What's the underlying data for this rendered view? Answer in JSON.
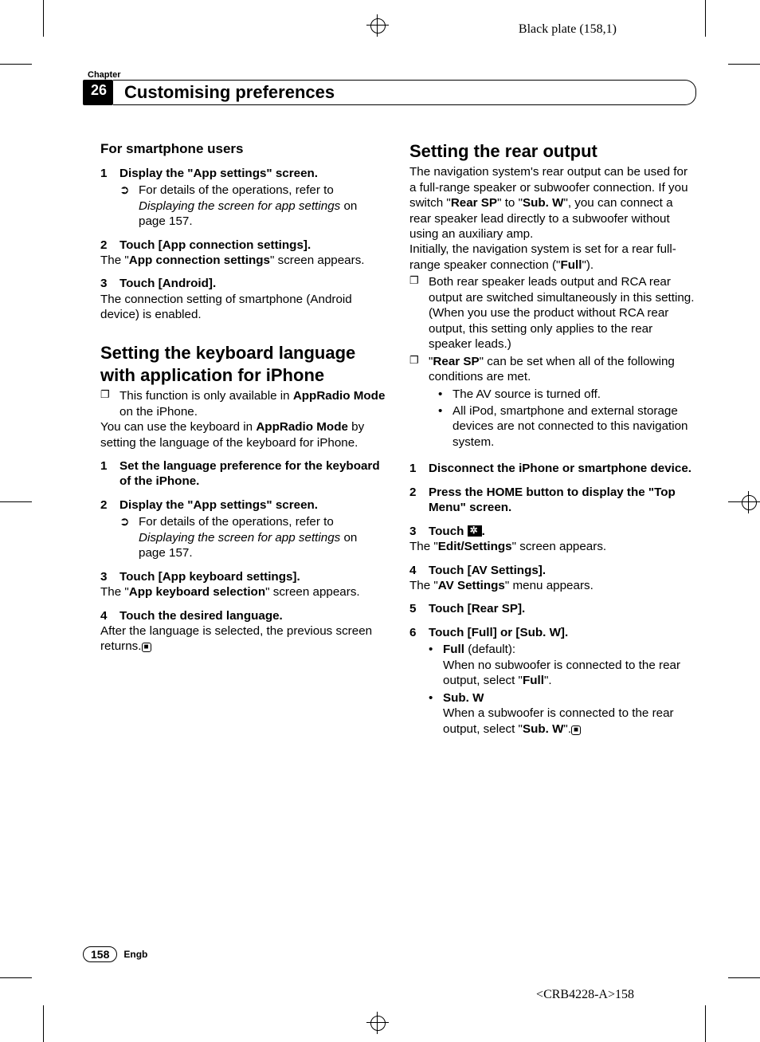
{
  "plate_label": "Black plate (158,1)",
  "chapter": {
    "label": "Chapter",
    "number": "26",
    "title": "Customising preferences"
  },
  "left": {
    "smartphone": {
      "heading": "For smartphone users",
      "s1": {
        "num": "1",
        "title": "Display the \"App settings\" screen."
      },
      "s1_ref_lead": "For details of the operations, refer to ",
      "s1_ref_ital": "Displaying the screen for app settings",
      "s1_ref_tail": " on page 157.",
      "s2": {
        "num": "2",
        "title": "Touch [App connection settings]."
      },
      "s2_body_a": "The \"",
      "s2_body_b": "App connection settings",
      "s2_body_c": "\" screen appears.",
      "s3": {
        "num": "3",
        "title": "Touch [Android]."
      },
      "s3_body": "The connection setting of smartphone (Android device) is enabled."
    },
    "keyboard": {
      "heading": "Setting the keyboard language with application for iPhone",
      "n1_a": "This function is only available in ",
      "n1_b": "AppRadio Mode",
      "n1_c": " on the iPhone.",
      "intro_a": "You can use the keyboard in ",
      "intro_b": "AppRadio Mode",
      "intro_c": " by setting the language of the keyboard for iPhone.",
      "s1": {
        "num": "1",
        "title": "Set the language preference for the keyboard of the iPhone."
      },
      "s2": {
        "num": "2",
        "title": "Display the \"App settings\" screen."
      },
      "s2_ref_lead": "For details of the operations, refer to ",
      "s2_ref_ital": "Displaying the screen for app settings",
      "s2_ref_tail": " on page 157.",
      "s3": {
        "num": "3",
        "title": "Touch [App keyboard settings]."
      },
      "s3_body_a": "The \"",
      "s3_body_b": "App keyboard selection",
      "s3_body_c": "\" screen appears.",
      "s4": {
        "num": "4",
        "title": "Touch the desired language."
      },
      "s4_body": "After the language is selected, the previous screen returns."
    }
  },
  "right": {
    "heading": "Setting the rear output",
    "p1_a": "The navigation system's rear output can be used for a full-range speaker or subwoofer connection. If you switch \"",
    "p1_b": "Rear SP",
    "p1_c": "\" to \"",
    "p1_d": "Sub. W",
    "p1_e": "\", you can connect a rear speaker lead directly to a subwoofer without using an auxiliary amp.",
    "p2_a": "Initially, the navigation system is set for a rear full-range speaker connection (\"",
    "p2_b": "Full",
    "p2_c": "\").",
    "b1": "Both rear speaker leads output and RCA rear output are switched simultaneously in this setting. (When you use the product without RCA rear output, this setting only applies to the rear speaker leads.)",
    "b2_a": "\"",
    "b2_b": "Rear SP",
    "b2_c": "\" can be set when all of the following conditions are met.",
    "b2_d1": "The AV source is turned off.",
    "b2_d2": "All iPod, smartphone and external storage devices are not connected to this navigation system.",
    "s1": {
      "num": "1",
      "title": "Disconnect the iPhone or smartphone device."
    },
    "s2": {
      "num": "2",
      "title": "Press the HOME button to display the \"Top Menu\" screen."
    },
    "s3": {
      "num": "3",
      "title_a": "Touch ",
      "title_b": "."
    },
    "s3_body_a": "The \"",
    "s3_body_b": "Edit/Settings",
    "s3_body_c": "\" screen appears.",
    "s4": {
      "num": "4",
      "title": "Touch [AV Settings]."
    },
    "s4_body_a": "The \"",
    "s4_body_b": "AV Settings",
    "s4_body_c": "\" menu appears.",
    "s5": {
      "num": "5",
      "title": "Touch [Rear SP]."
    },
    "s6": {
      "num": "6",
      "title": "Touch [Full] or [Sub. W]."
    },
    "o1_a": "Full",
    "o1_b": " (default):",
    "o1_c": "When no subwoofer is connected to the rear output, select \"",
    "o1_d": "Full",
    "o1_e": "\".",
    "o2_a": "Sub. W",
    "o2_c": "When a subwoofer is connected to the rear output, select \"",
    "o2_d": "Sub. W",
    "o2_e": "\"."
  },
  "footer": {
    "page": "158",
    "lang": "Engb",
    "folio": "<CRB4228-A>158"
  },
  "glyph": {
    "ref": "➲",
    "box": "❐",
    "dot": "•",
    "end": "■"
  }
}
